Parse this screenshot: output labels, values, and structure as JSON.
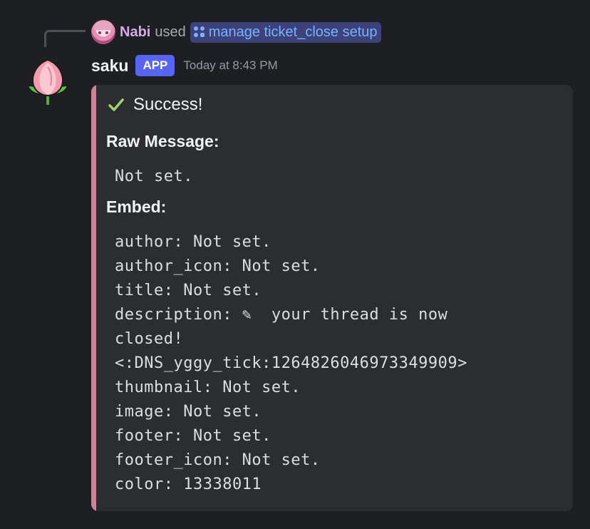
{
  "reply": {
    "user_name": "Nabi",
    "used_text": "used",
    "command": "manage ticket_close setup"
  },
  "message": {
    "author": "saku",
    "badge": "APP",
    "timestamp": "Today at 8:43 PM"
  },
  "embed": {
    "accent_color": "#cb8495",
    "status": "Success!",
    "raw_message_label": "Raw Message:",
    "raw_message_value": "Not set.",
    "embed_label": "Embed:",
    "lines": [
      "author: Not set.",
      "author_icon: Not set.",
      "title: Not set.",
      "description: ✎  your thread is now",
      "closed!",
      "<:DNS_yggy_tick:1264826046973349909>",
      "thumbnail: Not set.",
      "image: Not set.",
      "footer: Not set.",
      "footer_icon: Not set.",
      "color: 13338011"
    ]
  },
  "colors": {
    "background": "#1e1f22",
    "embed_background": "#2b2d31",
    "app_badge": "#5865f2",
    "command_pill": "#3b437a",
    "command_text": "#7ab0ff",
    "reply_name": "#d8a8ec",
    "check": "#a6d16b"
  },
  "icons": {
    "reply_avatar": "anime-girl-avatar",
    "command": "slash-command-icon",
    "bot_avatar": "pink-tulip-icon",
    "status": "checkmark-icon"
  }
}
